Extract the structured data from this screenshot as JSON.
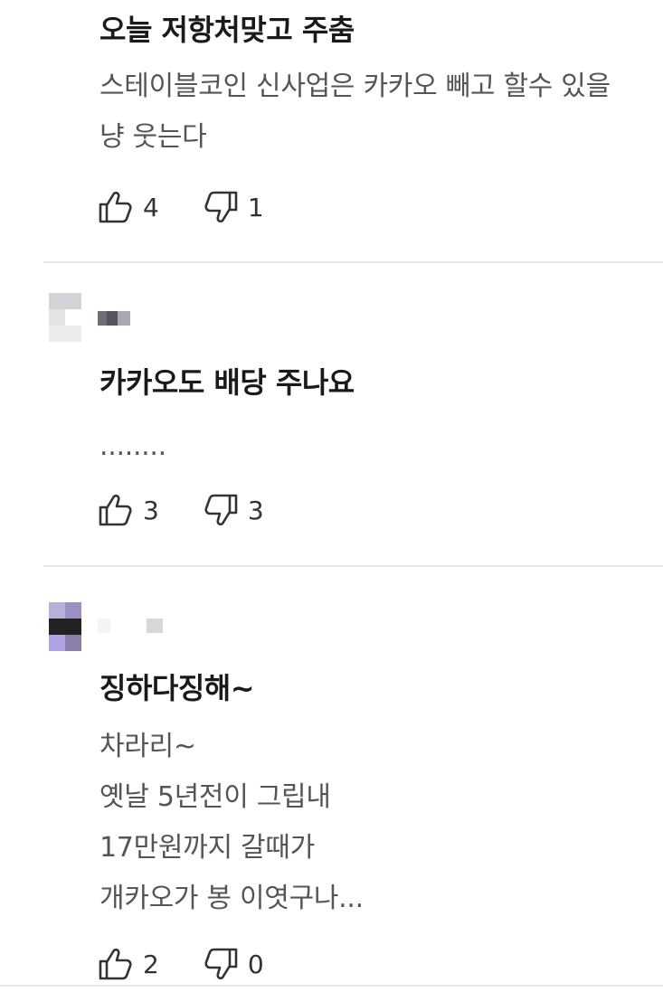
{
  "comments": [
    {
      "title": "오늘 저항처맞고 주춤",
      "body": "스테이블코인 신사업은 카카오 빼고 할수 있을\n냥 웃는다",
      "likes": "4",
      "dislikes": "1"
    },
    {
      "title": "카카오도 배당 주나요",
      "body": "........",
      "likes": "3",
      "dislikes": "3"
    },
    {
      "title": "징하다징해~",
      "body": "차라리~\n옛날 5년전이 그립내\n17만원까지 갈때가\n개카오가 봉 이엿구나...",
      "likes": "2",
      "dislikes": "0"
    }
  ],
  "icons": {
    "like": "thumbs-up-icon",
    "dislike": "thumbs-down-icon"
  },
  "colors": {
    "divider": "#e8e8ec",
    "title": "#1a1a1a",
    "body": "#555555",
    "avatar_purple": "#9b8fc4",
    "avatar_dark": "#222222"
  }
}
